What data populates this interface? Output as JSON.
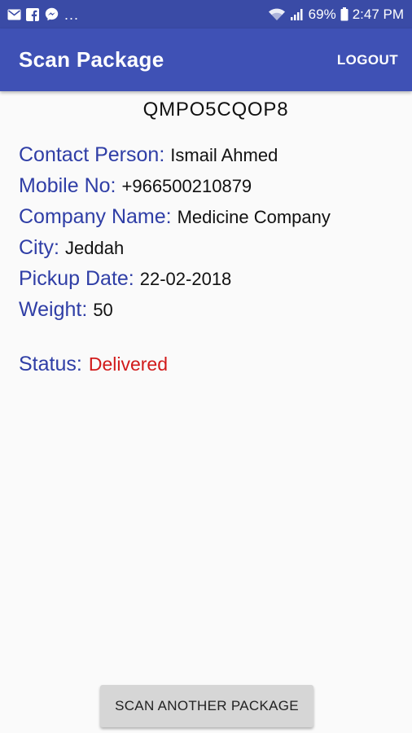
{
  "status_bar": {
    "icons_left": [
      "mail-icon",
      "facebook-icon",
      "messenger-icon"
    ],
    "overflow": "...",
    "battery_percent": "69%",
    "time": "2:47 PM"
  },
  "app_bar": {
    "title": "Scan Package",
    "logout_label": "LOGOUT",
    "color": "#3f51b5"
  },
  "package": {
    "code": "QMPO5CQOP8",
    "details": [
      {
        "label": "Contact Person:",
        "value": "Ismail Ahmed"
      },
      {
        "label": "Mobile No:",
        "value": "+966500210879"
      },
      {
        "label": "Company Name:",
        "value": "Medicine Company"
      },
      {
        "label": "City:",
        "value": "Jeddah"
      },
      {
        "label": "Pickup Date:",
        "value": "22-02-2018"
      },
      {
        "label": "Weight:",
        "value": "50"
      }
    ],
    "status_label": "Status:",
    "status_value": "Delivered",
    "status_color": "#d11a1a"
  },
  "actions": {
    "scan_another_label": "SCAN ANOTHER PACKAGE"
  }
}
